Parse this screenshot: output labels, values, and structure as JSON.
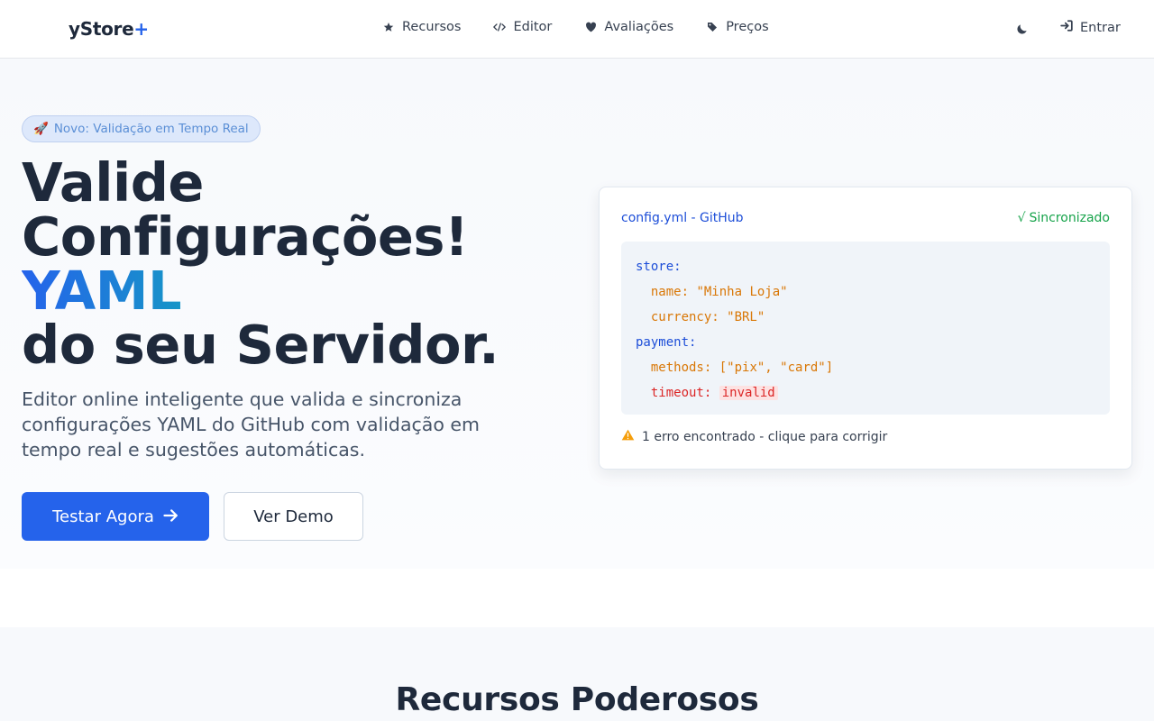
{
  "nav": {
    "logo_text": "yStore",
    "logo_plus": "+",
    "links": [
      {
        "label": "Recursos",
        "icon": "star-icon"
      },
      {
        "label": "Editor",
        "icon": "code-icon"
      },
      {
        "label": "Avaliações",
        "icon": "heart-icon"
      },
      {
        "label": "Preços",
        "icon": "tag-icon"
      }
    ],
    "theme_icon": "moon-icon",
    "login_label": "Entrar",
    "login_icon": "sign-in-icon"
  },
  "hero": {
    "badge_emoji": "🚀",
    "badge_text": "Novo: Validação em Tempo Real",
    "headline": {
      "line1": "Valide",
      "line2": "Configurações!",
      "highlight": "YAML",
      "line4": "do seu Servidor."
    },
    "subtitle": "Editor online inteligente que valida e sincroniza configurações YAML do GitHub com validação em tempo real e sugestões automáticas.",
    "primary_button": "Testar Agora",
    "secondary_button": "Ver Demo"
  },
  "editor_card": {
    "title": "config.yml - GitHub",
    "status_check": "√",
    "status": "Sincronizado",
    "code": {
      "l1_key": "store:",
      "l2_key": "  name:",
      "l2_val": " \"Minha Loja\"",
      "l3_key": "  currency:",
      "l3_val": " \"BRL\"",
      "l4_key": "payment:",
      "l5_key": "  methods:",
      "l5_val": " [\"pix\", \"card\"]",
      "l6_key": "  timeout:",
      "l6_val": "invalid"
    },
    "error_text": "1 erro encontrado - clique para corrigir"
  },
  "features": {
    "title": "Recursos Poderosos"
  },
  "colors": {
    "accent": "#2563eb",
    "success": "#16a34a",
    "warning": "#f59e0b",
    "error": "#dc2626"
  }
}
